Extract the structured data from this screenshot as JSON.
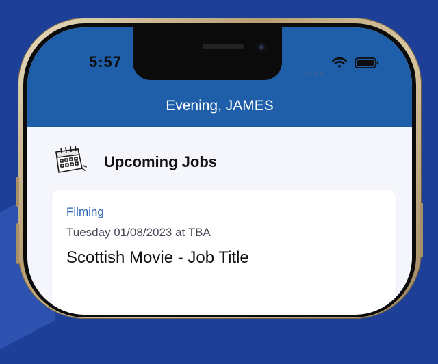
{
  "status_bar": {
    "time": "5:57",
    "wifi_icon": "wifi-icon",
    "battery_icon": "battery-icon"
  },
  "header": {
    "greeting": "Evening, JAMES",
    "background_color": "#1f5ea8"
  },
  "section": {
    "icon": "calendar-icon",
    "title": "Upcoming Jobs"
  },
  "jobs": [
    {
      "category": "Filming",
      "date": "Tuesday 01/08/2023 at TBA",
      "title": "Scottish Movie - Job Title"
    }
  ],
  "colors": {
    "accent": "#2a63b0",
    "page_background": "#1e3f98",
    "content_background": "#f4f6fb"
  }
}
